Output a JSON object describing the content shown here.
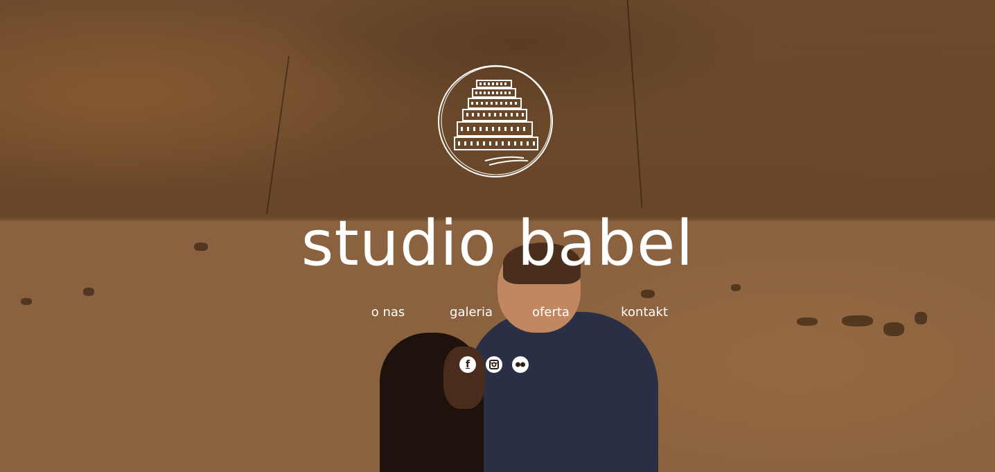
{
  "site": {
    "title": "studio babel",
    "logo_icon": "tower-of-babel-logo-icon"
  },
  "nav": {
    "items": [
      {
        "label": "o nas"
      },
      {
        "label": "galeria"
      },
      {
        "label": "oferta"
      },
      {
        "label": "kontakt"
      }
    ]
  },
  "social": {
    "facebook_glyph": "f",
    "icons": [
      "facebook-icon",
      "instagram-icon",
      "flickr-icon"
    ]
  },
  "colors": {
    "text": "#ffffff",
    "wall": "#8a623f"
  }
}
